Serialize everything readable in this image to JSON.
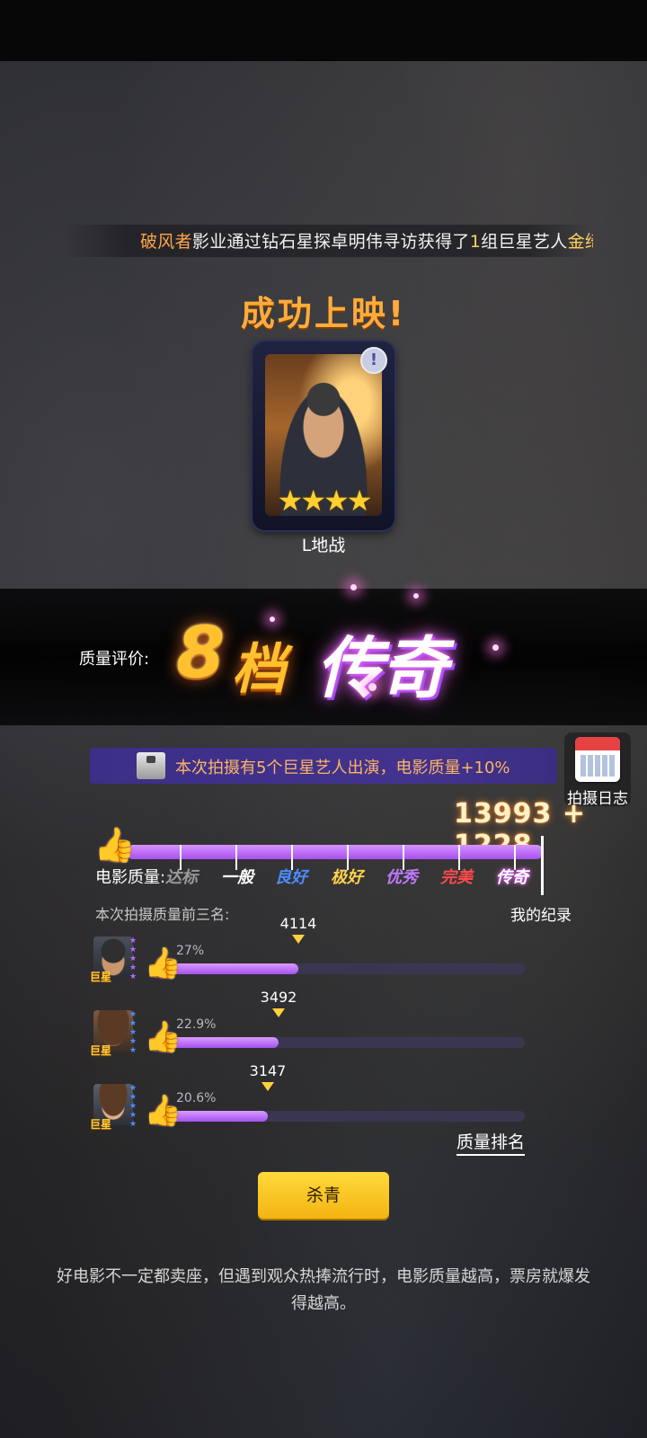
{
  "ticker": {
    "studio": "破风者",
    "middle": "影业通过钻石星探卓明伟寻访获得了",
    "count": "1",
    "after_count": "组巨星艺人",
    "star": "金绮灵"
  },
  "title": "成功上映!",
  "card": {
    "badge": "!",
    "stars": "★★★★",
    "star_count": 4,
    "name": "L地战"
  },
  "quality": {
    "label": "质量评价:",
    "grade_number": "8",
    "grade_unit": "档",
    "grade_word": "传奇"
  },
  "bonus": {
    "text": "本次拍摄有5个巨星艺人出演，电影质量+10%"
  },
  "log": {
    "label": "拍摄日志"
  },
  "score": {
    "base": "13993",
    "plus": "+",
    "bonus": "1228"
  },
  "quality_bar": {
    "label": "电影质量:",
    "levels": [
      {
        "text": "达标",
        "color": "#9a9a9a"
      },
      {
        "text": "一般",
        "color": "#ffffff"
      },
      {
        "text": "良好",
        "color": "#4d8cff"
      },
      {
        "text": "极好",
        "color": "#ffd24a"
      },
      {
        "text": "优秀",
        "color": "#c079ff"
      },
      {
        "text": "完美",
        "color": "#ff4a4a"
      },
      {
        "text": "传奇",
        "color": "#ffffff"
      }
    ],
    "record_label": "我的纪录"
  },
  "top3": {
    "title": "本次拍摄质量前三名:",
    "rows": [
      {
        "tag": "巨星",
        "percent": "27%",
        "fraction": 0.27,
        "score": "4114",
        "star_color": "#b36bff"
      },
      {
        "tag": "巨星",
        "percent": "22.9%",
        "fraction": 0.229,
        "score": "3492",
        "star_color": "#4d8cff"
      },
      {
        "tag": "巨星",
        "percent": "20.6%",
        "fraction": 0.206,
        "score": "3147",
        "star_color": "#4d8cff"
      }
    ],
    "rank_link": "质量排名"
  },
  "wrap_button": "杀青",
  "tip": "好电影不一定都卖座，但遇到观众热捧流行时，电影质量越高，票房就爆发得越高。"
}
